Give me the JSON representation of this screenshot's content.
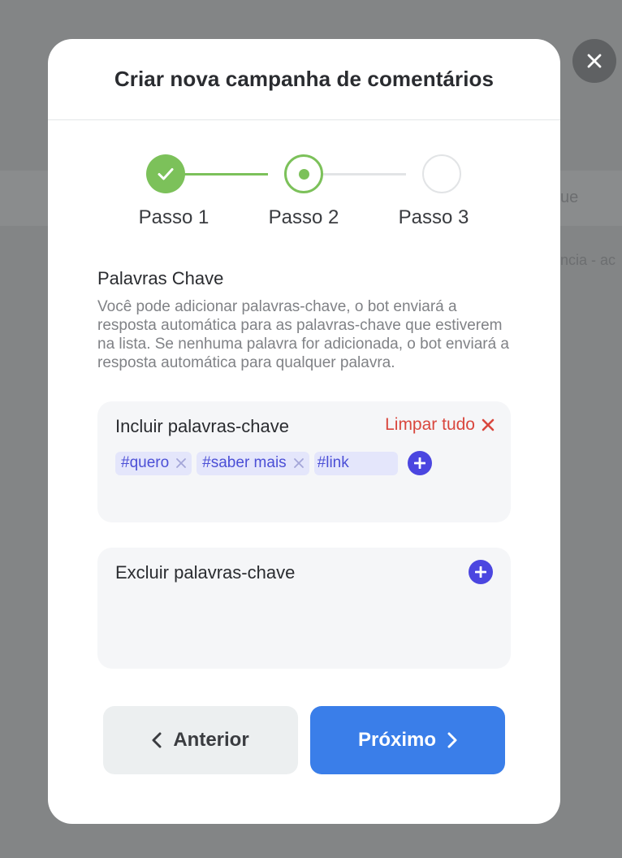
{
  "background": {
    "partial_text_1": "ue",
    "partial_text_2": "ncia - ac"
  },
  "modal": {
    "title": "Criar nova campanha de comentários"
  },
  "stepper": {
    "steps": [
      {
        "label": "Passo 1",
        "status": "completed"
      },
      {
        "label": "Passo 2",
        "status": "current"
      },
      {
        "label": "Passo 3",
        "status": "pending"
      }
    ]
  },
  "keywords": {
    "title": "Palavras Chave",
    "description": "Você pode adicionar palavras-chave, o bot enviará a resposta automática para as palavras-chave que estiverem na lista. Se nenhuma palavra for adicionada, o bot enviará a resposta automática para qualquer palavra."
  },
  "include": {
    "title": "Incluir palavras-chave",
    "clear_label": "Limpar tudo",
    "tags": [
      "#quero",
      "#saber mais"
    ],
    "input_value": "#link"
  },
  "exclude": {
    "title": "Excluir palavras-chave"
  },
  "footer": {
    "prev_label": "Anterior",
    "next_label": "Próximo"
  },
  "colors": {
    "accent_green": "#7cc15a",
    "primary_blue": "#3a7ee9",
    "tag_indigo": "#4b46e0",
    "danger_red": "#d9473e"
  },
  "icons": {
    "close": "close-icon",
    "check": "check-icon",
    "tag_remove": "x-icon",
    "add": "plus-circle-icon",
    "prev": "chevron-left-icon",
    "next": "chevron-right-icon"
  }
}
